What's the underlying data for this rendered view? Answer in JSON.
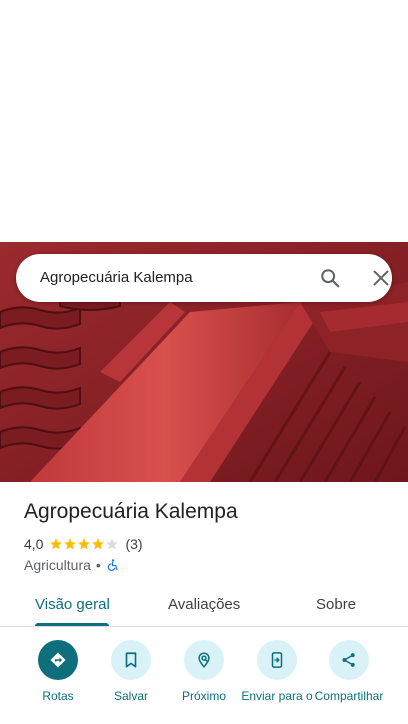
{
  "search": {
    "query": "Agropecuária Kalempa"
  },
  "place": {
    "name": "Agropecuária Kalempa",
    "rating": "4,0",
    "stars_filled": 4,
    "stars_total": 5,
    "review_count": "(3)",
    "category": "Agricultura",
    "separator": "•"
  },
  "tabs": [
    {
      "label": "Visão geral",
      "active": true
    },
    {
      "label": "Avaliações",
      "active": false
    },
    {
      "label": "Sobre",
      "active": false
    }
  ],
  "actions": [
    {
      "label": "Rotas",
      "icon": "directions-icon"
    },
    {
      "label": "Salvar",
      "icon": "bookmark-icon"
    },
    {
      "label": "Próximo",
      "icon": "nearby-icon"
    },
    {
      "label": "Enviar para o",
      "icon": "send-to-phone-icon"
    },
    {
      "label": "Compartilhar",
      "icon": "share-icon"
    }
  ],
  "colors": {
    "accent": "#0f6e7c",
    "accent_light": "#d9f2f8",
    "star": "#fbbc04",
    "roof": "#8a1f24"
  }
}
